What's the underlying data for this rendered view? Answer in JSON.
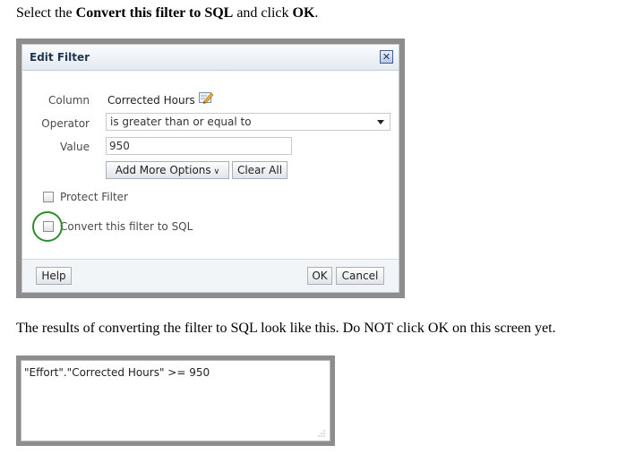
{
  "instruction1": {
    "prefix": "Select the ",
    "bold1": "Convert this filter to SQL",
    "middle": " and click ",
    "bold2": "OK",
    "suffix": "."
  },
  "dialog": {
    "title": "Edit Filter",
    "close_icon": "close-icon",
    "column": {
      "label": "Column",
      "value": "Corrected Hours",
      "icon": "pencil-edit-icon"
    },
    "operator": {
      "label": "Operator",
      "value": "is greater than or equal to"
    },
    "value": {
      "label": "Value",
      "value": "950"
    },
    "add_more_options_label": "Add More Options",
    "clear_all_label": "Clear All",
    "protect_filter_label": "Protect Filter",
    "protect_filter_checked": false,
    "convert_sql_label": "Convert this filter to SQL",
    "convert_sql_checked": false,
    "help_label": "Help",
    "ok_label": "OK",
    "cancel_label": "Cancel"
  },
  "instruction2": "The results of converting the filter to SQL look like this.  Do NOT click OK on this screen yet.",
  "sql_box": {
    "text": "\"Effort\".\"Corrected Hours\" >= 950"
  },
  "colors": {
    "highlight": "#2e8b2e",
    "frame": "#8d8d8d",
    "title_text": "#1f3550"
  }
}
